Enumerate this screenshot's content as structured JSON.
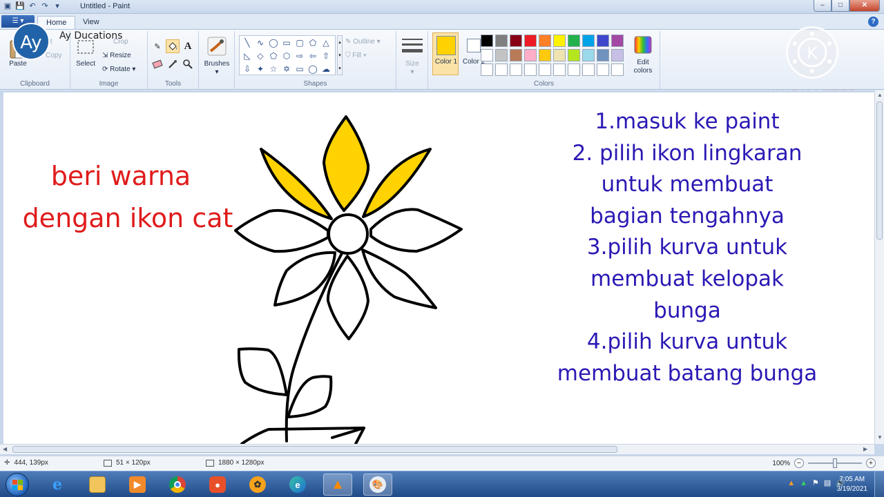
{
  "window": {
    "title": "Untitled - Paint",
    "controls": {
      "minimize": "–",
      "maximize": "□",
      "close": "✕"
    }
  },
  "quick_access": [
    "save-icon",
    "undo-icon",
    "redo-icon",
    "customize-icon"
  ],
  "tabs": {
    "app_menu": "☰ ▾",
    "home": "Home",
    "view": "View",
    "help": "?"
  },
  "ribbon": {
    "clipboard": {
      "label": "Clipboard",
      "paste": "Paste",
      "cut": "Cut",
      "copy": "Copy"
    },
    "image": {
      "label": "Image",
      "select": "Select",
      "crop": "Crop",
      "resize": "Resize",
      "rotate": "Rotate"
    },
    "tools": {
      "label": "Tools"
    },
    "brushes": {
      "label": "Brushes"
    },
    "shapes": {
      "label": "Shapes",
      "outline": "Outline",
      "fill": "Fill"
    },
    "size": {
      "label": "Size"
    },
    "colors": {
      "label": "Colors",
      "color1": "Color 1",
      "color2": "Color 2",
      "edit": "Edit colors",
      "color1_value": "#ffd200",
      "color2_value": "#ffffff",
      "palette": [
        "#000000",
        "#7f7f7f",
        "#880015",
        "#ed1c24",
        "#ff7f27",
        "#fff200",
        "#22b14c",
        "#00a2e8",
        "#3f48cc",
        "#a349a4",
        "#ffffff",
        "#c3c3c3",
        "#b97a57",
        "#ffaec9",
        "#ffc90e",
        "#efe4b0",
        "#b5e61d",
        "#99d9ea",
        "#7092be",
        "#c8bfe7",
        "#ffffff",
        "#ffffff",
        "#ffffff",
        "#ffffff",
        "#ffffff",
        "#ffffff",
        "#ffffff",
        "#ffffff",
        "#ffffff",
        "#ffffff"
      ]
    }
  },
  "overlay": {
    "channel_badge": "Ay",
    "channel_name": "Ay Ducations",
    "watermark": "KINEMASTER",
    "watermark_logo": "K"
  },
  "canvas": {
    "red_instruction": [
      "beri warna",
      "dengan ikon cat"
    ],
    "steps": [
      "1.masuk ke paint",
      "2. pilih ikon lingkaran",
      "untuk membuat",
      "bagian tengahnya",
      "3.pilih kurva untuk",
      "membuat kelopak",
      "bunga",
      "4.pilih kurva untuk",
      "membuat batang bunga"
    ],
    "colors": {
      "red": "#e01b1b",
      "blue": "#2a19b4",
      "petal_fill": "#ffd200"
    }
  },
  "statusbar": {
    "cursor": "444, 139px",
    "selection": "51 × 120px",
    "canvas_size": "1880 × 1280px",
    "zoom": "100%",
    "zoom_level": 1.0
  },
  "taskbar": {
    "apps": [
      "internet-explorer",
      "file-explorer",
      "media-player",
      "chrome",
      "screen-recorder",
      "fl-studio",
      "edge",
      "vlc",
      "paint"
    ],
    "time": "7:05 AM",
    "date": "3/19/2021"
  }
}
